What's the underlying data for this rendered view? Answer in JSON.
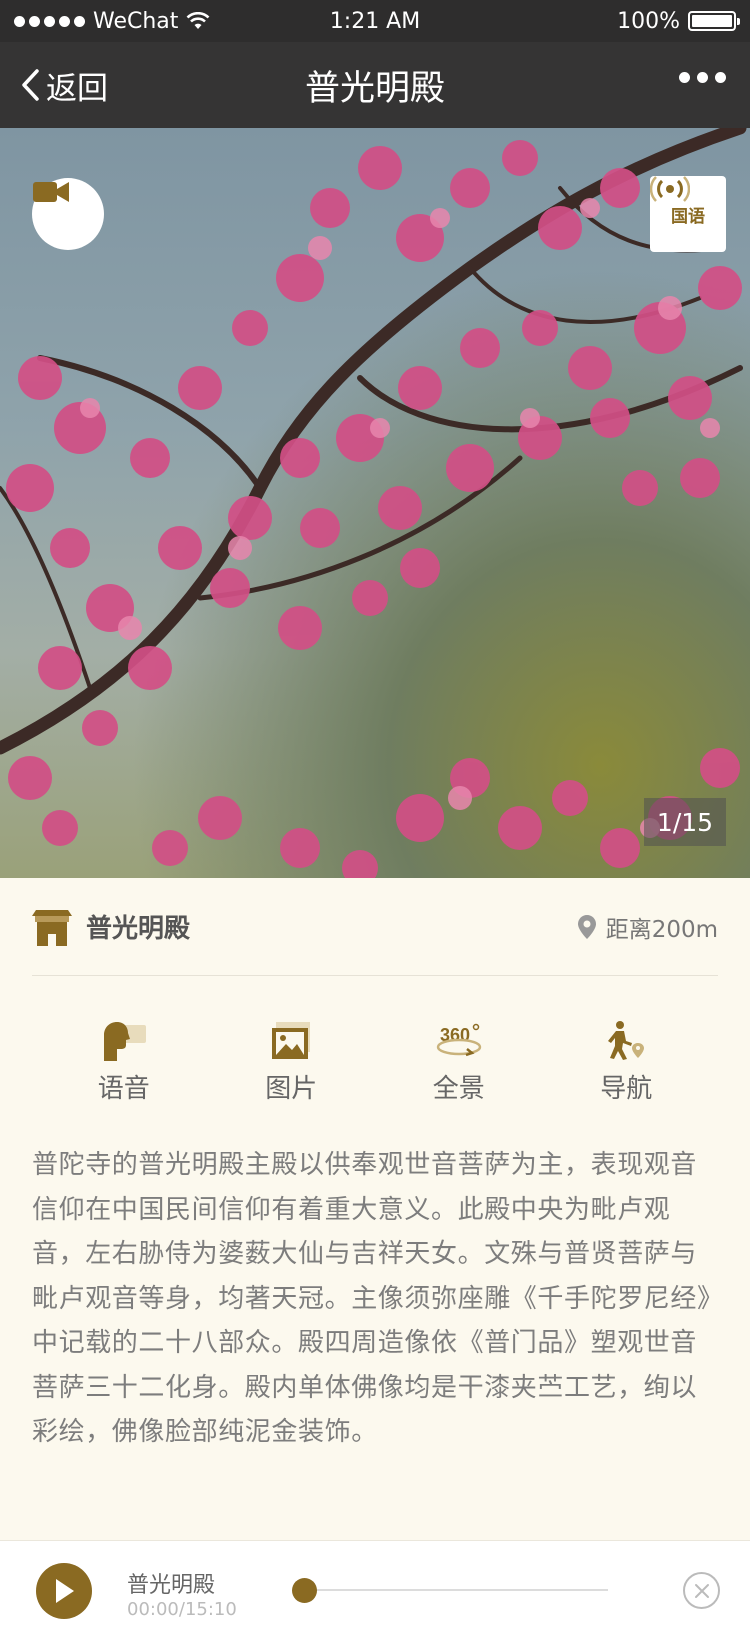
{
  "status_bar": {
    "carrier": "WeChat",
    "time": "1:21 AM",
    "battery": "100%"
  },
  "nav": {
    "back_label": "返回",
    "title": "普光明殿"
  },
  "hero": {
    "lang_label": "国语",
    "counter": "1/15"
  },
  "info": {
    "place_name": "普光明殿",
    "distance": "距离200m"
  },
  "actions": [
    {
      "label": "语音",
      "icon": "speaker-head-icon"
    },
    {
      "label": "图片",
      "icon": "picture-icon"
    },
    {
      "label": "全景",
      "icon": "panorama-360-icon"
    },
    {
      "label": "导航",
      "icon": "walking-navigation-icon"
    }
  ],
  "description": "普陀寺的普光明殿主殿以供奉观世音菩萨为主，表现观音信仰在中国民间信仰有着重大意义。此殿中央为毗卢观音，左右胁侍为婆薮大仙与吉祥天女。文殊与普贤菩萨与毗卢观音等身，均著天冠。主像须弥座雕《千手陀罗尼经》中记载的二十八部众。殿四周造像依《普门品》塑观世音菩萨三十二化身。殿内单体佛像均是干漆夹苎工艺，绚以彩绘，佛像脸部纯泥金装饰。",
  "player": {
    "title": "普光明殿",
    "time": "00:00/15:10",
    "progress": 0
  },
  "colors": {
    "accent": "#8a6a22",
    "nav_bg": "#353434",
    "page_bg": "#fcf9ee"
  }
}
